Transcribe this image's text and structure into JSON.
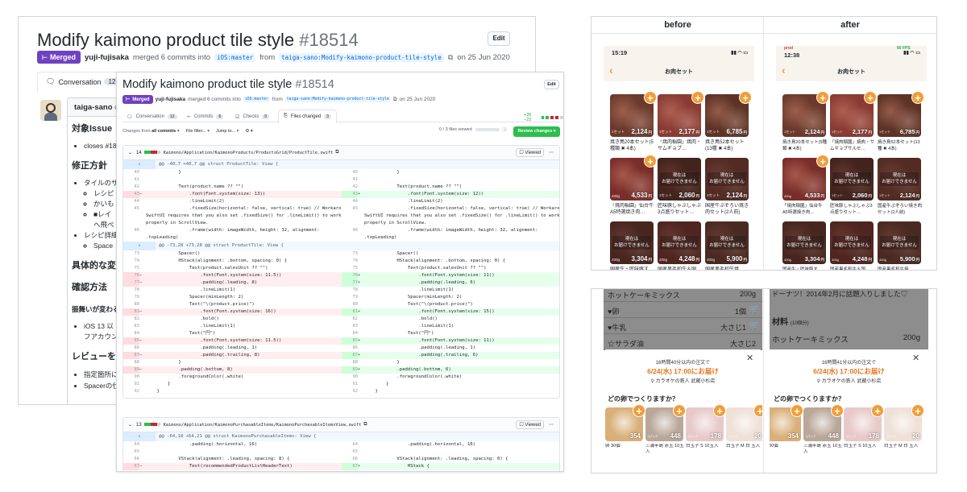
{
  "pr": {
    "title": "Modify kaimono product tile style",
    "number": "#18514",
    "edit_label": "Edit",
    "merged_label": "Merged",
    "author": "yuji-fujisaka",
    "merged_text": "merged 6 commits into",
    "base_branch": "iOS:master",
    "from_text": "from",
    "head_branch": "taiga-sano:Modify-kaimono-product-tile-style",
    "date_text": "on 25 Jun 2020"
  },
  "back": {
    "tab_conversation": "Conversation",
    "tab_conversation_count": "12",
    "commenter": "taiga-sano",
    "comment_prefix": "co",
    "sections": {
      "issue": "対象Issue",
      "issue_item": "closes #18",
      "policy": "修正方針",
      "policy_item1": "タイルのサ",
      "policy_sub1": "レシピ",
      "policy_sub2": "かいも",
      "policy_sub3": "■レイ",
      "policy_sub3b": "へ飛ぺ",
      "policy_item2": "レシピ詳細",
      "policy_sub4": "Space",
      "changes": "具体的な変更",
      "verify": "確認方法",
      "behavior": "振舞いが変わる",
      "verify_item": "iOS 13 以",
      "verify_item2": "フアカウン",
      "review": "レビューをお",
      "review_item1": "指定箇所に",
      "review_item2": "Spacerの仕"
    }
  },
  "front": {
    "tabs": [
      {
        "label": "Conversation",
        "count": "12"
      },
      {
        "label": "Commits",
        "count": "6"
      },
      {
        "label": "Checks",
        "count": "0"
      },
      {
        "label": "Files changed",
        "count": "3"
      }
    ],
    "diffstat": "+26 −22",
    "changes_from": "Changes from",
    "all_commits": "all commits",
    "file_filter": "File filter...",
    "jump_to": "Jump to...",
    "files_viewed": "0 / 3 files viewed",
    "review_btn": "Review changes",
    "viewed_label": "Viewed",
    "file1": {
      "count": "14",
      "path": "Kaimono/Application/KaimonoProducts/ProductsGrid/ProductTile.swift",
      "hunk1": "@@ -40,7 +40,7 @@ struct ProductTile: View {",
      "hunk2": "@@ -73,28 +73,28 @@ struct ProductTile: View {"
    },
    "file2": {
      "count": "13",
      "path": "Kaimono/Application/KaimonoPurchasableItems/KaimonoPurchasableItemsView.swift",
      "hunk1": "@@ -64,18 +64,21 @@ struct KaimonoPurchasableItems: View {"
    },
    "diff_lines_1": [
      {
        "l": "40",
        "r": "40",
        "lt": "            }",
        "rt": "            }",
        "type": "ctx"
      },
      {
        "l": "41",
        "r": "41",
        "lt": "",
        "rt": "",
        "type": "ctx"
      },
      {
        "l": "42",
        "r": "42",
        "lt": "            Text(product.name ?? \"\")",
        "rt": "            Text(product.name ?? \"\")",
        "type": "ctx"
      },
      {
        "l": "43",
        "r": "43",
        "lt": "                .font(Font.system(size: 13))",
        "rt": "                .font(Font.system(size: 12))",
        "type": "chg"
      },
      {
        "l": "44",
        "r": "44",
        "lt": "                .lineLimit(2)",
        "rt": "                .lineLimit(2)",
        "type": "ctx"
      },
      {
        "l": "45",
        "r": "45",
        "lt": "                .fixedSize(horizontal: false, vertical: true) // Workaround:",
        "rt": "                .fixedSize(horizontal: false, vertical: true) // Workaround:",
        "type": "ctx"
      },
      {
        "l": "",
        "r": "",
        "lt": "SwiftUI requires that you also set .fixedSize() for .lineLimit() to work",
        "rt": "SwiftUI requires that you also set .fixedSize() for .lineLimit() to work",
        "type": "ctx"
      },
      {
        "l": "",
        "r": "",
        "lt": "properly in ScrollView.",
        "rt": "properly in ScrollView.",
        "type": "ctx"
      },
      {
        "l": "46",
        "r": "46",
        "lt": "                .frame(width: imageWidth, height: 32, alignment:",
        "rt": "                .frame(width: imageWidth, height: 32, alignment:",
        "type": "ctx"
      },
      {
        "l": "",
        "r": "",
        "lt": ".topLeading)",
        "rt": ".topLeading)",
        "type": "ctx"
      }
    ],
    "diff_lines_2": [
      {
        "l": "73",
        "r": "73",
        "lt": "            Spacer()",
        "rt": "            Spacer()",
        "type": "ctx"
      },
      {
        "l": "74",
        "r": "74",
        "lt": "            HStack(alignment: .bottom, spacing: 0) {",
        "rt": "            HStack(alignment: .bottom, spacing: 0) {",
        "type": "ctx"
      },
      {
        "l": "75",
        "r": "75",
        "lt": "                Text(product.salesUnit ?? \"\")",
        "rt": "                Text(product.salesUnit ?? \"\")",
        "type": "ctx"
      },
      {
        "l": "76",
        "r": "76",
        "lt": "                    .font(Font.system(size: 11.5))",
        "rt": "                    .font(Font.system(size: 11))",
        "type": "chg"
      },
      {
        "l": "77",
        "r": "77",
        "lt": "                    .padding(.leading, 8)",
        "rt": "                    .padding(.leading, 6)",
        "type": "chg"
      },
      {
        "l": "78",
        "r": "78",
        "lt": "                    .lineLimit(1)",
        "rt": "                    .lineLimit(1)",
        "type": "ctx"
      },
      {
        "l": "79",
        "r": "79",
        "lt": "                Spacer(minLength: 2)",
        "rt": "                Spacer(minLength: 2)",
        "type": "ctx"
      },
      {
        "l": "80",
        "r": "80",
        "lt": "                Text(\"\\(product.price)\")",
        "rt": "                Text(\"\\(product.price)\")",
        "type": "ctx"
      },
      {
        "l": "81",
        "r": "81",
        "lt": "                    .font(Font.system(size: 16))",
        "rt": "                    .font(Font.system(size: 15))",
        "type": "chg"
      },
      {
        "l": "82",
        "r": "82",
        "lt": "                    .bold()",
        "rt": "                    .bold()",
        "type": "ctx"
      },
      {
        "l": "83",
        "r": "83",
        "lt": "                    .lineLimit(1)",
        "rt": "                    .lineLimit(1)",
        "type": "ctx"
      },
      {
        "l": "84",
        "r": "84",
        "lt": "                Text(\"円\")",
        "rt": "                Text(\"円\")",
        "type": "ctx"
      },
      {
        "l": "85",
        "r": "85",
        "lt": "                    .font(Font.system(size: 11.5))",
        "rt": "                    .font(Font.system(size: 11))",
        "type": "chg"
      },
      {
        "l": "86",
        "r": "86",
        "lt": "                    .padding(.leading, 1)",
        "rt": "                    .padding(.leading, 1)",
        "type": "ctx"
      },
      {
        "l": "87",
        "r": "87",
        "lt": "                    .padding(.trailing, 8)",
        "rt": "                    .padding(.trailing, 6)",
        "type": "chg"
      },
      {
        "l": "88",
        "r": "88",
        "lt": "            }",
        "rt": "            }",
        "type": "ctx"
      },
      {
        "l": "89",
        "r": "89",
        "lt": "            .padding(.bottom, 8)",
        "rt": "            .padding(.bottom, 6)",
        "type": "chg"
      },
      {
        "l": "90",
        "r": "90",
        "lt": "            .foregroundColor(.white)",
        "rt": "            .foregroundColor(.white)",
        "type": "ctx"
      },
      {
        "l": "91",
        "r": "91",
        "lt": "        }",
        "rt": "        }",
        "type": "ctx"
      },
      {
        "l": "92",
        "r": "92",
        "lt": "    }",
        "rt": "    }",
        "type": "ctx"
      }
    ],
    "diff_lines_3": [
      {
        "l": "64",
        "r": "64",
        "lt": "                .padding(.horizontal, 16)",
        "rt": "                .padding(.horizontal, 16)",
        "type": "ctx"
      },
      {
        "l": "65",
        "r": "65",
        "lt": "",
        "rt": "",
        "type": "ctx"
      },
      {
        "l": "66",
        "r": "66",
        "lt": "            VStack(alignment: .leading, spacing: 8) {",
        "rt": "            VStack(alignment: .leading, spacing: 0) {",
        "type": "ctx"
      },
      {
        "l": "67",
        "r": "67",
        "lt": "                Text(recommendedProductListHeaderText)",
        "rt": "                HStack {",
        "type": "chg"
      }
    ]
  },
  "app": {
    "before_label": "before",
    "after_label": "after",
    "time_before": "15:19",
    "time_after": "12:38",
    "prod_label": "prod",
    "fps_label": "60 FPS",
    "screen_title": "お肉セット",
    "soldout_text_1": "現在は",
    "soldout_text_2": "お届けできません",
    "before_tiles": [
      {
        "price": "2,124",
        "unit": "1セット",
        "name": "焼き鳥20本セット(5種類 ✖ 4本)",
        "soldout": false
      },
      {
        "price": "2,177",
        "unit": "1セット",
        "name": "「焼肉稲園」焼肉・サムギョプ…",
        "soldout": false
      },
      {
        "price": "6,785",
        "unit": "1セット",
        "name": "焼き鳥52本セット(13種 ✖ 4本)",
        "soldout": false
      },
      {
        "price": "4,533",
        "unit": "400g",
        "name": "「焼肉稲園」仙台牛A5特選焼き肉…",
        "soldout": false
      },
      {
        "price": "2,060",
        "unit": "1セット",
        "name": "匠味豚しゃぶしゃぶ3点盛りセット…",
        "soldout": true
      },
      {
        "price": "2,124",
        "unit": "1セット",
        "name": "国産牛ぷぞろい焼き肉セット(2人前)",
        "soldout": true
      },
      {
        "price": "3,304",
        "unit": "400g",
        "name": "国産牛・匠味豚す",
        "soldout": true
      },
      {
        "price": "4,248",
        "unit": "400g",
        "name": "国産黒毛和牛＆国",
        "soldout": true
      },
      {
        "price": "5,900",
        "unit": "400g",
        "name": "国産黒毛和牛焼",
        "soldout": true
      }
    ],
    "after_tiles": [
      {
        "price": "2,124",
        "unit": "1セット",
        "name": "焼き鳥20本セット(5種類 ✖ 4本)",
        "soldout": false
      },
      {
        "price": "2,177",
        "unit": "1セット",
        "name": "「焼肉稲園」焼肉・サムギョプサルセ…",
        "soldout": false
      },
      {
        "price": "6,785",
        "unit": "1セット",
        "name": "焼き鳥52本セット(13種 ✖ 4本)",
        "soldout": false
      },
      {
        "price": "4,533",
        "unit": "400g",
        "name": "「焼肉稲園」仙台牛A5特選焼き肉…",
        "soldout": false
      },
      {
        "price": "2,060",
        "unit": "1セット",
        "name": "匠味豚しゃぶしゃぶ3点盛りセット…",
        "soldout": true
      },
      {
        "price": "2,124",
        "unit": "1セット",
        "name": "国産牛ぷぞろい焼き肉セット(2人前)",
        "soldout": true
      },
      {
        "price": "3,304",
        "unit": "400g",
        "name": "国産牛・匠味豚す",
        "soldout": true
      },
      {
        "price": "4,248",
        "unit": "400g",
        "name": "国産黒毛和牛＆国",
        "soldout": true
      },
      {
        "price": "5,900",
        "unit": "400g",
        "name": "国産黒毛和牛焼",
        "soldout": true
      }
    ],
    "bottom": {
      "before_rows": [
        {
          "name": "ホットケーキミックス",
          "qty": "200g"
        },
        {
          "name": "♥卵",
          "qty": "1個"
        },
        {
          "name": "♥牛乳",
          "qty": "大さじ1"
        },
        {
          "name": "☆サラダ油",
          "qty": "大さじ2"
        }
      ],
      "after_top": "ドーナツ！2014年2月に話題入りしました♡",
      "after_material": "材料",
      "after_servings": "(10個分)",
      "after_row_name": "ホットケーキミックス",
      "after_row_qty": "200g",
      "delivery_before": "16時間40分以内の注文で",
      "delivery_after": "16時間41分以内の注文で",
      "delivery_date": "6/24(水) 17:00にお届け",
      "store": "カラオケの鉄人 武蔵小杉店",
      "egg_question": "どの卵でつくりますか？",
      "egg_tiles": [
        {
          "price": "354",
          "unit": "",
          "name": "卵 30個"
        },
        {
          "price": "448",
          "unit": "1パック",
          "name": "三浦半島 赤玉 10玉入"
        },
        {
          "price": "178",
          "unit": "1パック",
          "name": "白玉子 S 10玉入"
        },
        {
          "price": "20",
          "unit": "1パック",
          "name": "白玉子 M 白 玉入"
        }
      ]
    }
  }
}
